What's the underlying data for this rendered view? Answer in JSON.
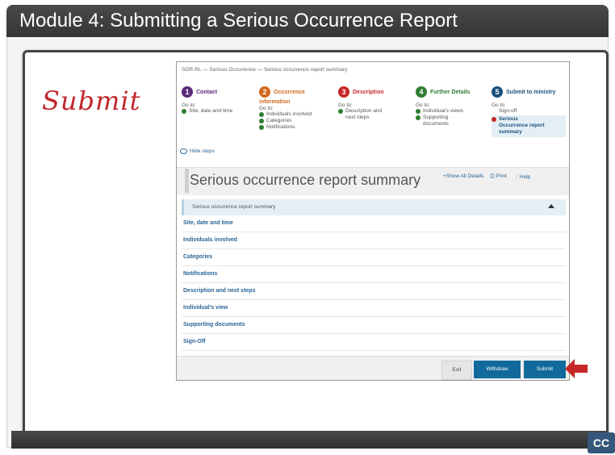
{
  "module_title": "Module 4:  Submitting a Serious Occurrence Report",
  "annotation": "Submit",
  "cc_label": "CC",
  "breadcrumb": "SOR-RL  —  Serious Occurrence  —  Serious occurrence report summary",
  "steps": [
    {
      "num": "1",
      "name": "Contact",
      "color": "#5b2a7a",
      "goto": "Go to:",
      "items": [
        "Site, date and time"
      ]
    },
    {
      "num": "2",
      "name": "Occurrence",
      "color": "#d2691e",
      "name2": "information",
      "goto": "Go to:",
      "items": [
        "Individuals involved",
        "Categories",
        "Notifications"
      ]
    },
    {
      "num": "3",
      "name": "Description",
      "color": "#c62828",
      "goto": "Go to:",
      "items": [
        "Description and",
        "next steps"
      ]
    },
    {
      "num": "4",
      "name": "Further Details",
      "color": "#2e7d32",
      "goto": "Go to:",
      "items": [
        "Individual's views",
        "Supporting",
        "documents"
      ]
    },
    {
      "num": "5",
      "name": "Submit to ministry",
      "color": "#1a4f7a",
      "goto": "Go to:",
      "items": [
        "Sign-off",
        "Serious",
        "Occurrence report",
        "summary"
      ]
    }
  ],
  "hide_steps": "Hide steps",
  "summary_title": "Serious occurrence report summary",
  "top_links": {
    "show_all": "+Show All Details",
    "print": "Print",
    "help": "Help"
  },
  "section_header": "Serious occurrence report summary",
  "sections": [
    "Site, date and time",
    "Individuals involved",
    "Categories",
    "Notifications",
    "Description and next steps",
    "Individual's view",
    "Supporting documents",
    "Sign-Off"
  ],
  "buttons": {
    "exit": "Exit",
    "withdraw": "Withdraw",
    "submit": "Submit"
  },
  "colors": {
    "primary": "#126a9c",
    "annotation": "#c0272d",
    "arrow": "#c62828"
  }
}
